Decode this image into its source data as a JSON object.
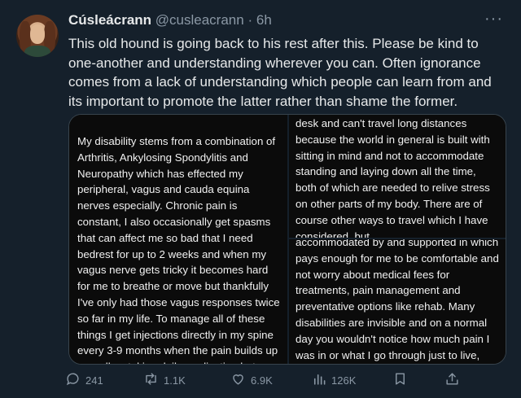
{
  "tweet": {
    "display_name": "Cúsleácrann",
    "handle": "@cusleacrann",
    "separator": "·",
    "time": "6h",
    "more": "···",
    "text": "This old hound is going back to his rest after this. Please be kind to one-another and understanding wherever you can. Often ignorance comes from a lack of understanding which people can learn from and its important to promote the latter rather than shame the former."
  },
  "media": {
    "left_image_text": "My disability stems from a combination of Arthritis, Ankylosing Spondylitis and Neuropathy which has effected my peripheral, vagus and cauda equina nerves especially. Chronic pain is constant, I also occasionally get spasms that can affect me so bad that I need bedrest for up to 2 weeks and when my vagus nerve gets tricky it becomes hard for me to breathe or move but thankfully I've only had those vagus responses twice so far in my life. To manage all of these things I get injections directly in my spine every 3-9 months when the pain builds up as well as taking daily medication but there is",
    "top_right_image_text": "desk and can't travel long distances because the world in general is built with sitting in mind and not to accommodate standing and laying down all the time, both of which are needed to relive stress on other parts of my body. There are of course other ways to travel which I have considered, but",
    "bottom_right_image_text": "accommodated by and supported in which pays enough for me to be comfortable and not worry about medical fees for treatments, pain management and preventative options like rehab. Many disabilities are invisible and on a normal day you wouldn't notice how much pain I was in or what I go through just to live, other than maybe"
  },
  "actions": {
    "replies": "241",
    "retweets": "1.1K",
    "likes": "6.9K",
    "views": "126K"
  },
  "colors": {
    "background": "#15202b",
    "text": "#e7e9ea",
    "muted": "#8b98a5",
    "media_bg": "#0b0b0b"
  }
}
